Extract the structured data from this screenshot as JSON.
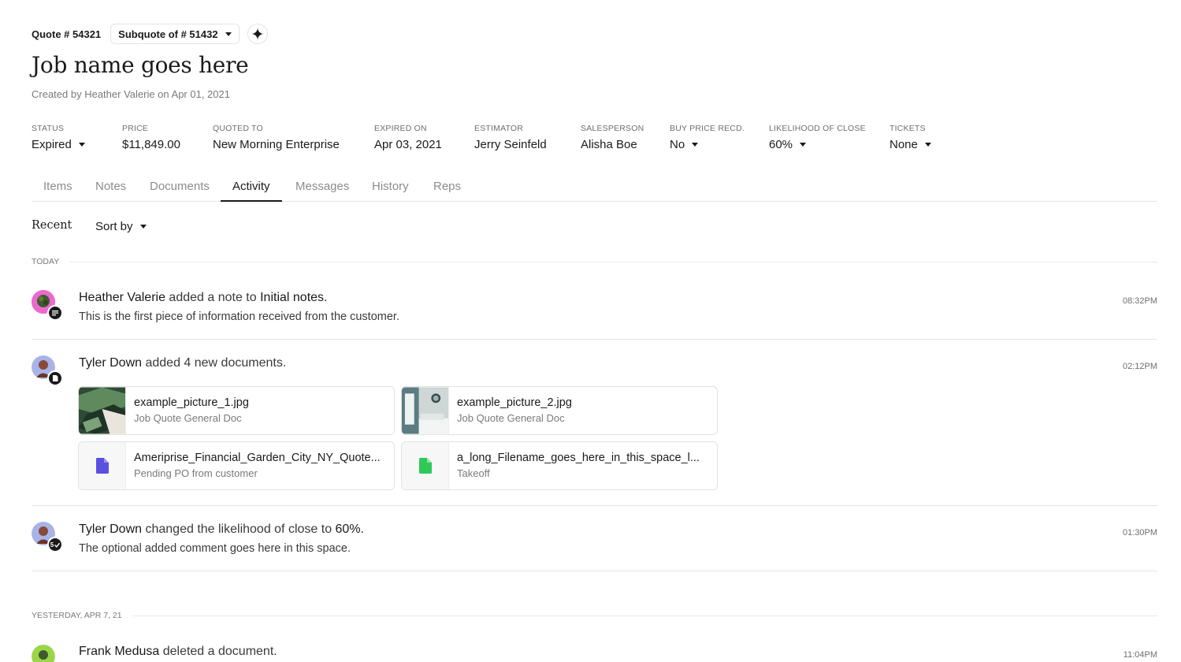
{
  "header": {
    "quote_number": "Quote # 54321",
    "subquote_label": "Subquote of # 51432",
    "ai_button_icon": "sparkle-icon",
    "job_title": "Job name goes here",
    "created_text": "Created by Heather Valerie on Apr 01, 2021"
  },
  "meta": {
    "status": {
      "label": "STATUS",
      "value": "Expired"
    },
    "price": {
      "label": "PRICE",
      "value": "$11,849.00"
    },
    "quoted_to": {
      "label": "QUOTED TO",
      "value": "New Morning Enterprise"
    },
    "expired_on": {
      "label": "EXPIRED ON",
      "value": "Apr 03, 2021"
    },
    "estimator": {
      "label": "ESTIMATOR",
      "value": "Jerry Seinfeld"
    },
    "salesperson": {
      "label": "SALESPERSON",
      "value": "Alisha Boe"
    },
    "buy_price": {
      "label": "BUY PRICE RECD.",
      "value": "No"
    },
    "likelihood": {
      "label": "LIKELIHOOD OF CLOSE",
      "value": "60%"
    },
    "tickets": {
      "label": "TICKETS",
      "value": "None"
    }
  },
  "tabs": [
    {
      "label": "Items",
      "active": false
    },
    {
      "label": "Notes",
      "active": false
    },
    {
      "label": "Documents",
      "active": false
    },
    {
      "label": "Activity",
      "active": true
    },
    {
      "label": "Messages",
      "active": false
    },
    {
      "label": "History",
      "active": false
    },
    {
      "label": "Reps",
      "active": false
    }
  ],
  "filters": {
    "recent_label": "Recent",
    "sort_label": "Sort by"
  },
  "sections": {
    "today": "TODAY",
    "yesterday": "YESTERDAY, APR 7, 21"
  },
  "activities": [
    {
      "actor": "Heather Valerie",
      "action": " added a note to ",
      "target": "Initial notes.",
      "subtitle": "This is the first piece of information received from the customer.",
      "time": "08:32PM",
      "badge_icon": "note-icon"
    },
    {
      "actor": "Tyler Down",
      "action": " added 4 new documents.",
      "time": "02:12PM",
      "badge_icon": "document-icon",
      "documents": [
        {
          "name": "example_picture_1.jpg",
          "type": "Job Quote General Doc",
          "thumb": "plant-photo-thumbnail"
        },
        {
          "name": "example_picture_2.jpg",
          "type": "Job Quote General Doc",
          "thumb": "room-photo-thumbnail"
        },
        {
          "name": "Ameriprise_Financial_Garden_City_NY_Quote...",
          "type": "Pending PO from customer",
          "thumb": "file-icon",
          "color": "#5b4fe0"
        },
        {
          "name": "a_long_Filename_goes_here_in_this_space_l...",
          "type": "Takeoff",
          "thumb": "file-icon",
          "color": "#2fc95a"
        }
      ]
    },
    {
      "actor": "Tyler Down",
      "action": " changed the likelihood of close to ",
      "target": "60%.",
      "subtitle": "The optional added comment goes here in this space.",
      "time": "01:30PM",
      "badge_text": "5",
      "badge_icon": "check-icon"
    },
    {
      "actor": "Frank Medusa",
      "action": " deleted a document.",
      "time": "11:04PM"
    }
  ],
  "colors": {
    "text": "#1a1a1a",
    "muted": "#7a7a7a",
    "border": "#e6e6e6",
    "pdf_icon": "#5b4fe0",
    "sheet_icon": "#2fc95a"
  }
}
